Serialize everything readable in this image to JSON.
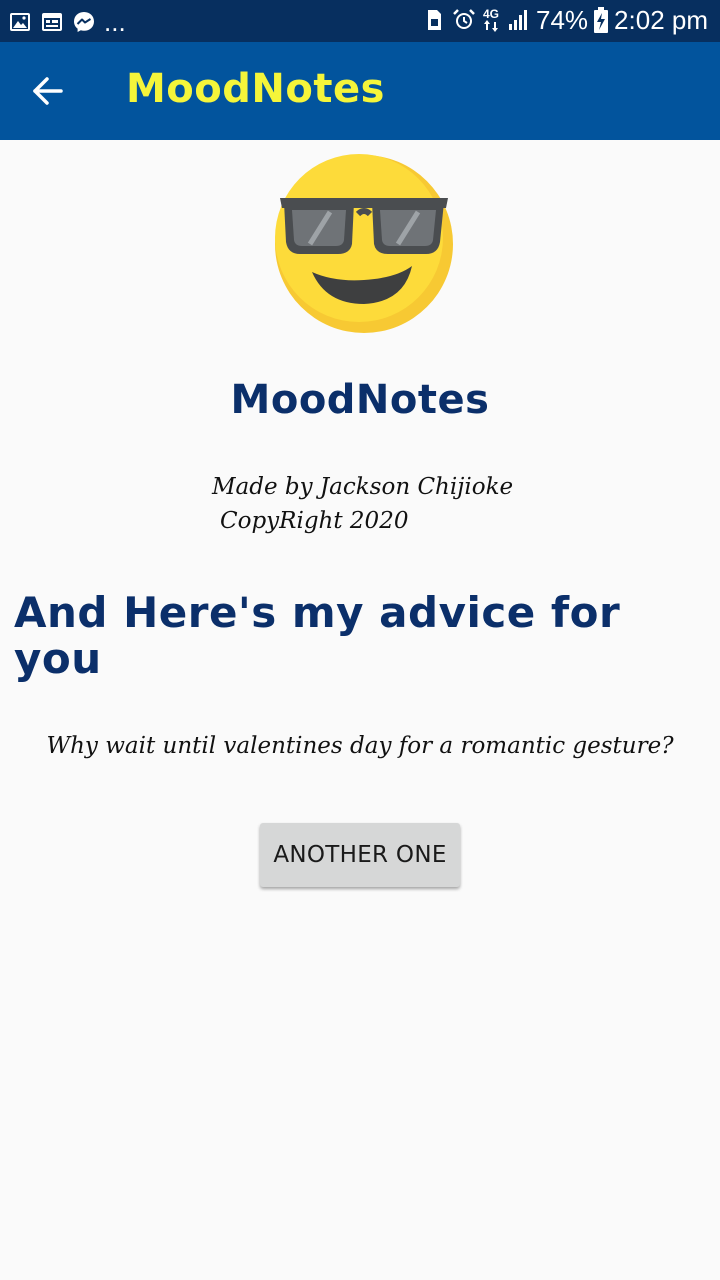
{
  "status_bar": {
    "more_indicator": "...",
    "network": "4G",
    "battery": "74%",
    "time": "2:02 pm",
    "icons": [
      "image-icon",
      "calendar-icon",
      "messenger-icon",
      "sim-icon",
      "alarm-icon",
      "data-arrows-icon",
      "signal-icon",
      "battery-icon"
    ]
  },
  "app_bar": {
    "title": "MoodNotes",
    "back_icon": "back-arrow-icon",
    "background": "#02549d",
    "title_color": "#f5f53a"
  },
  "main": {
    "emoji": "sunglasses-smiley-icon",
    "brand_title": "MoodNotes",
    "credit_line": "Made by Jackson Chijioke",
    "copyright": "CopyRight 2020",
    "advice_heading": "And Here's my advice for you",
    "advice_text": "Why wait until valentines day for a romantic gesture?",
    "button_label": "ANOTHER ONE",
    "heading_color": "#0b2f6a"
  }
}
